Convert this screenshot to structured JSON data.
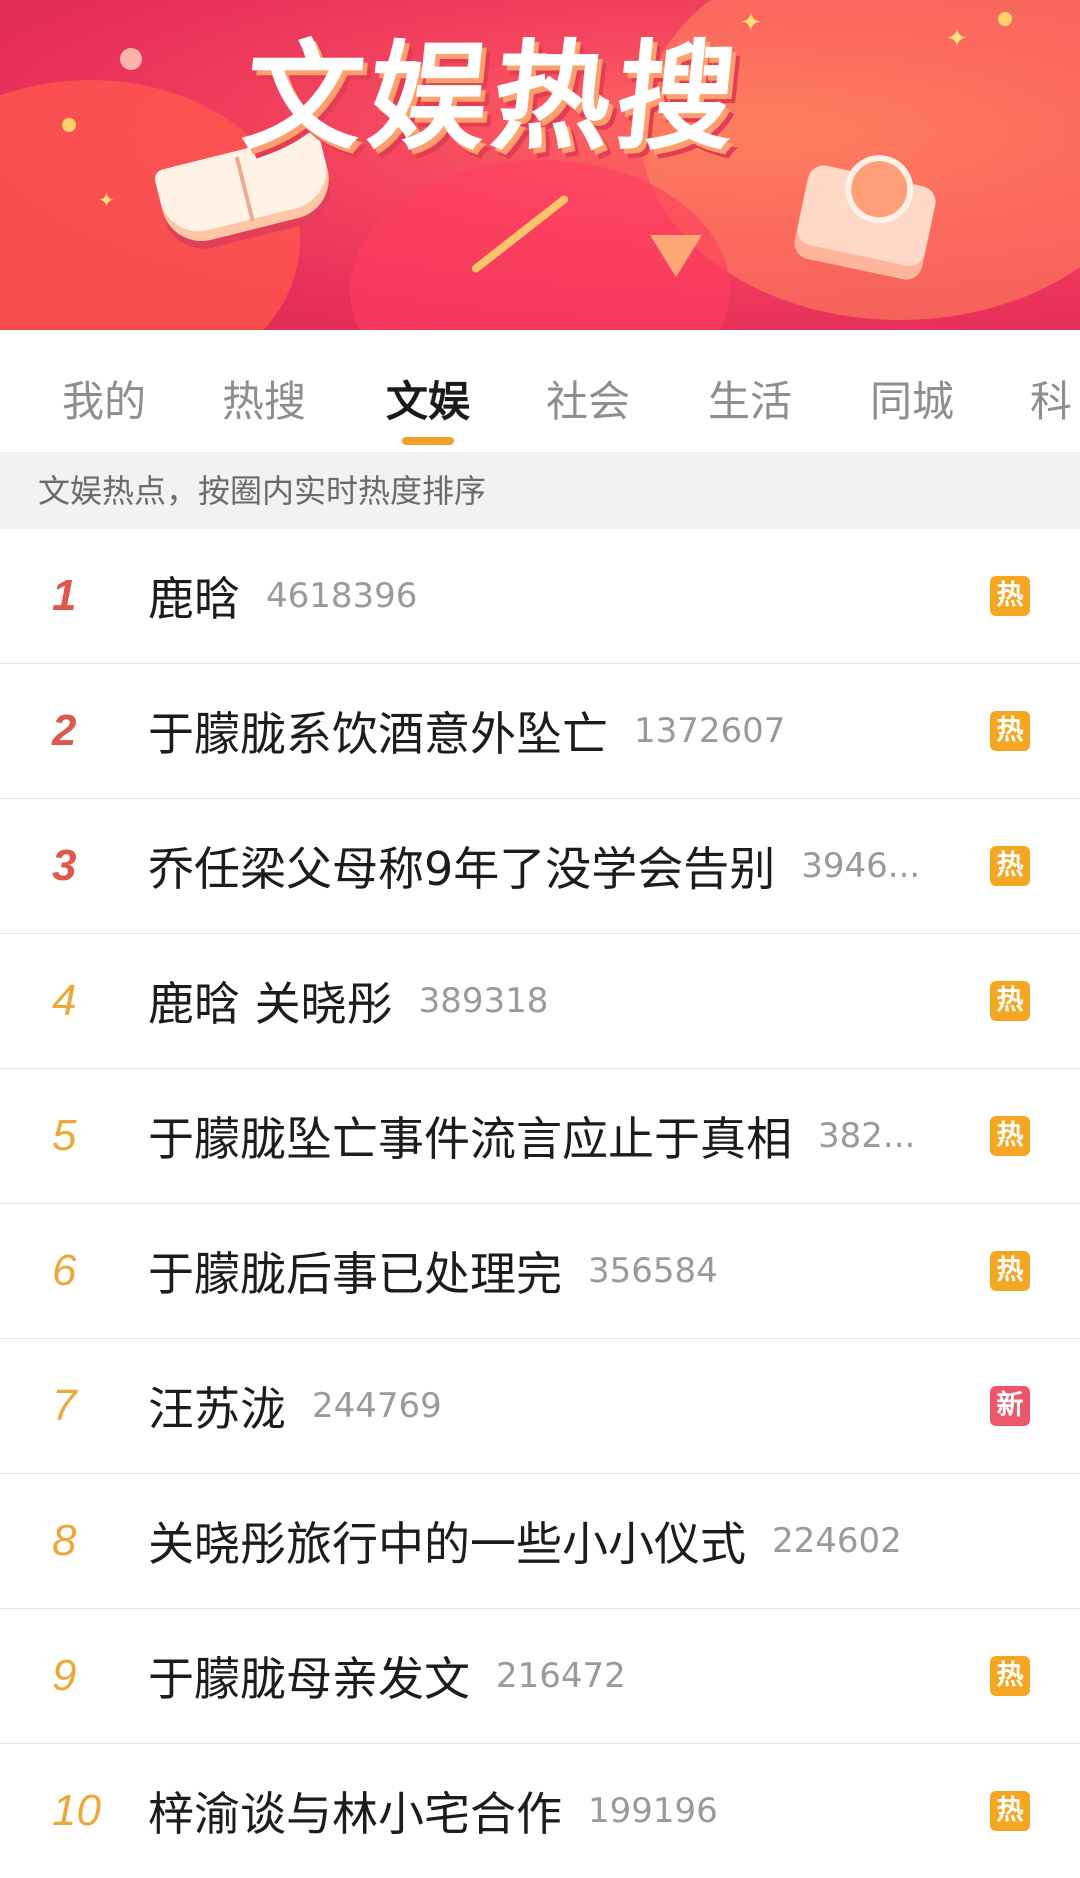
{
  "banner": {
    "title": "文娱热搜"
  },
  "tabs": [
    {
      "label": "我的"
    },
    {
      "label": "热搜"
    },
    {
      "label": "文娱"
    },
    {
      "label": "社会"
    },
    {
      "label": "生活"
    },
    {
      "label": "同城"
    },
    {
      "label": "科"
    }
  ],
  "subheader": {
    "text": "文娱热点，按圈内实时热度排序"
  },
  "list": {
    "items": [
      {
        "rank": "1",
        "title": "鹿晗",
        "count": "4618396",
        "badge": "热"
      },
      {
        "rank": "2",
        "title": "于朦胧系饮酒意外坠亡",
        "count": "1372607",
        "badge": "热"
      },
      {
        "rank": "3",
        "title": "乔任梁父母称9年了没学会告别",
        "count": "3946...",
        "badge": "热"
      },
      {
        "rank": "4",
        "title": "鹿晗 关晓彤",
        "count": "389318",
        "badge": "热"
      },
      {
        "rank": "5",
        "title": "于朦胧坠亡事件流言应止于真相",
        "count": "382...",
        "badge": "热"
      },
      {
        "rank": "6",
        "title": "于朦胧后事已处理完",
        "count": "356584",
        "badge": "热"
      },
      {
        "rank": "7",
        "title": "汪苏泷",
        "count": "244769",
        "badge": "新"
      },
      {
        "rank": "8",
        "title": "关晓彤旅行中的一些小小仪式",
        "count": "224602",
        "badge": ""
      },
      {
        "rank": "9",
        "title": "于朦胧母亲发文",
        "count": "216472",
        "badge": "热"
      },
      {
        "rank": "10",
        "title": "梓渝谈与林小宅合作",
        "count": "199196",
        "badge": "热"
      }
    ]
  },
  "colors": {
    "rank_top": "#e0584b",
    "rank_mid": "#eda83a",
    "badge_hot": "#f5a623",
    "badge_new": "#f0566b",
    "tab_underline": "#f2a12e"
  }
}
